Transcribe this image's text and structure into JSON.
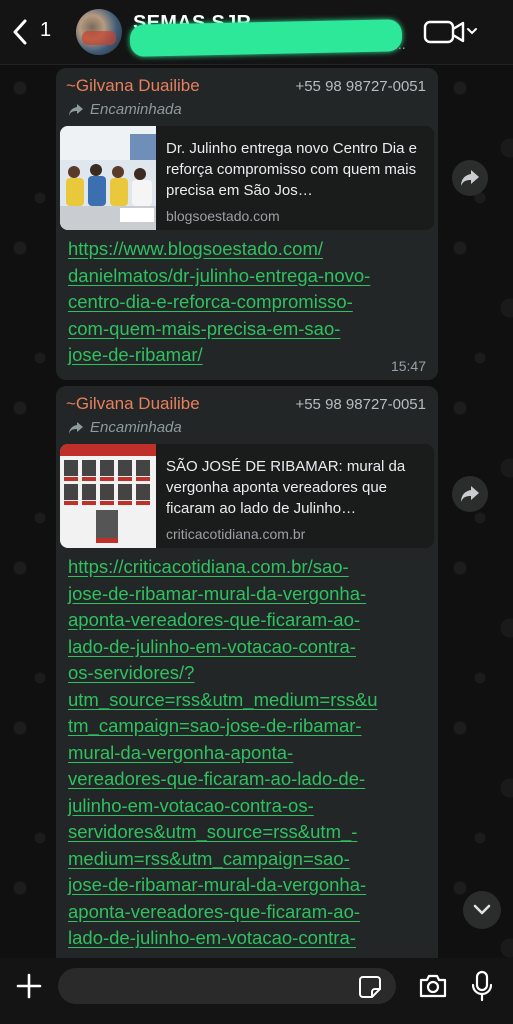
{
  "header": {
    "back_count": "1",
    "group_name": "SEMAS SJR",
    "subtitle_ellipsis": "..."
  },
  "messages": [
    {
      "sender": "~Gilvana Duailibe",
      "phone": "+55 98 98727-0051",
      "forwarded_label": "Encaminhada",
      "preview_title": "Dr. Julinho entrega novo Centro Dia e reforça compromisso com quem mais precisa em São Jos…",
      "preview_domain": "blogsoestado.com",
      "link": "https://www.blogsoestado.com/\ndanielmatos/dr-julinho-entrega-novo-\ncentro-dia-e-reforca-compromisso-\ncom-quem-mais-precisa-em-sao-\njose-de-ribamar/",
      "time": "15:47"
    },
    {
      "sender": "~Gilvana Duailibe",
      "phone": "+55 98 98727-0051",
      "forwarded_label": "Encaminhada",
      "preview_title": "SÃO JOSÉ DE RIBAMAR: mural da vergonha aponta vereadores que ficaram ao lado de Julinho…",
      "preview_domain": "criticacotidiana.com.br",
      "link": "https://criticacotidiana.com.br/sao-\njose-de-ribamar-mural-da-vergonha-\naponta-vereadores-que-ficaram-ao-\nlado-de-julinho-em-votacao-contra-\nos-servidores/?\nutm_source=rss&utm_medium=rss&u\ntm_campaign=sao-jose-de-ribamar-\nmural-da-vergonha-aponta-\nvereadores-que-ficaram-ao-lado-de-\njulinho-em-votacao-contra-os-\nservidores&utm_source=rss&utm_-\nmedium=rss&utm_campaign=sao-\njose-de-ribamar-mural-da-vergonha-\naponta-vereadores-que-ficaram-ao-\nlado-de-julinho-em-votacao-contra-"
    }
  ],
  "composer": {
    "placeholder": ""
  },
  "icons": [
    "back-chevron-icon",
    "video-call-icon",
    "forwarded-arrow-icon",
    "share-icon",
    "chevron-down-icon",
    "plus-icon",
    "sticker-icon",
    "camera-icon",
    "microphone-icon"
  ],
  "colors": {
    "link": "#2fc160",
    "sender": "#e87f5e",
    "bubble": "#232626",
    "redaction_highlight": "#2ee89a"
  }
}
